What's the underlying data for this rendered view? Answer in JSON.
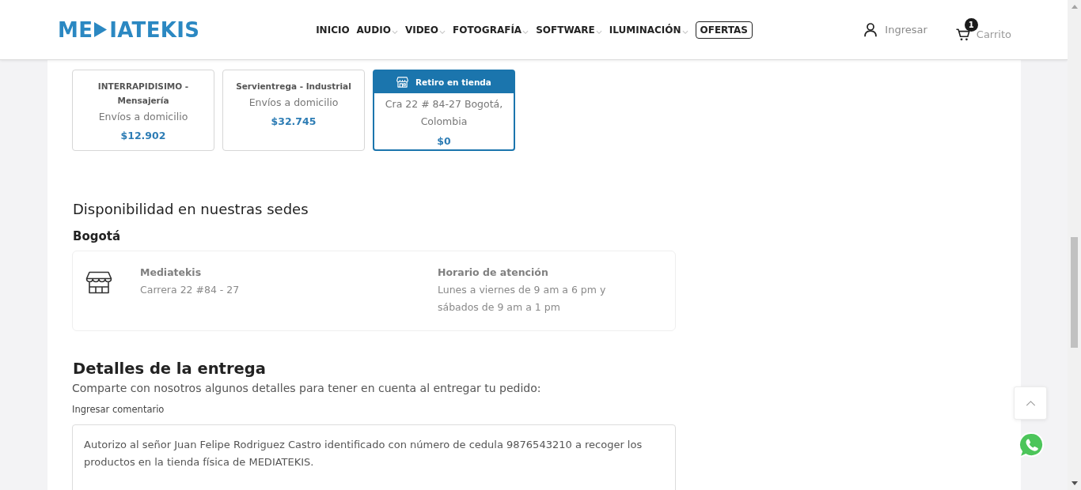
{
  "header": {
    "logo": {
      "text_start": "ME",
      "text_end": "IATEKIS"
    },
    "nav": [
      {
        "label": "INICIO",
        "kind": "plain"
      },
      {
        "label": "AUDIO",
        "kind": "dropdown"
      },
      {
        "label": "VIDEO",
        "kind": "dropdown"
      },
      {
        "label": "FOTOGRAFÍA",
        "kind": "dropdown"
      },
      {
        "label": "SOFTWARE",
        "kind": "dropdown"
      },
      {
        "label": "ILUMINACIÓN",
        "kind": "dropdown"
      },
      {
        "label": "OFERTAS",
        "kind": "outlined"
      }
    ],
    "account": {
      "label": "Ingresar"
    },
    "cart": {
      "label": "Carrito",
      "count": "1"
    }
  },
  "shipping_options": [
    {
      "kind": "carrier",
      "title": "INTERRAPIDISIMO - Mensajería",
      "subtitle": "Envíos a domicilio",
      "price": "$12.902",
      "selected": false
    },
    {
      "kind": "carrier",
      "title": "Servientrega - Industrial",
      "subtitle": "Envíos a domicilio",
      "price": "$32.745",
      "selected": false
    },
    {
      "kind": "pickup",
      "title": "Retiro en tienda",
      "address": "Cra 22 # 84-27 Bogotá, Colombia",
      "price": "$0",
      "selected": true
    }
  ],
  "availability": {
    "title": "Disponibilidad en nuestras sedes",
    "city": "Bogotá",
    "store": {
      "name": "Mediatekis",
      "address": "Carrera 22 #84 - 27",
      "hours_title": "Horario de atención",
      "hours": "Lunes a viernes de 9 am a 6 pm y sábados de 9 am a 1 pm"
    }
  },
  "delivery_details": {
    "title": "Detalles de la entrega",
    "description": "Comparte con nosotros algunos detalles para tener en cuenta al entregar tu pedido:",
    "comment_label": "Ingresar comentario",
    "comment": "Autorizo al señor Juan Felipe Rodriguez Castro identificado con número de cedula 9876543210 a recoger los productos en la tienda física de MEDIATEKIS."
  }
}
